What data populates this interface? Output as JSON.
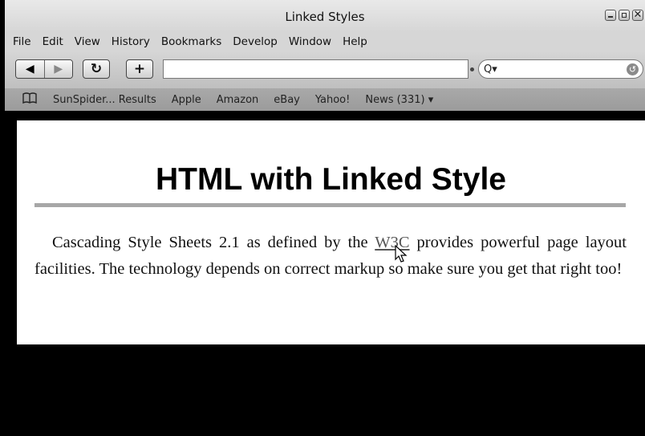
{
  "window": {
    "title": "Linked Styles",
    "close_glyph": "✕"
  },
  "menu": [
    "File",
    "Edit",
    "View",
    "History",
    "Bookmarks",
    "Develop",
    "Window",
    "Help"
  ],
  "toolbar": {
    "back_icon": "◀",
    "forward_icon": "▶",
    "reload_icon": "↻",
    "add_icon": "+",
    "url_value": "",
    "search_icon": "Q▾",
    "search_value": ""
  },
  "bookmarks": {
    "book_icon": "📖",
    "items": [
      "SunSpider... Results",
      "Apple",
      "Amazon",
      "eBay",
      "Yahoo!",
      "News (331) ▾"
    ]
  },
  "page": {
    "heading": "HTML with Linked Style",
    "text_before": "Cascading Style Sheets 2.1 as defined by the ",
    "link_text": "W3C",
    "text_after": " provides powerful page layout facilities. The technology depends on correct markup so make sure you get that right too!"
  },
  "colors": {
    "chrome": "#d6d6d6",
    "bookmarks_bar": "#a3a3a3",
    "rule": "#a7a7a7",
    "background": "#000000"
  }
}
